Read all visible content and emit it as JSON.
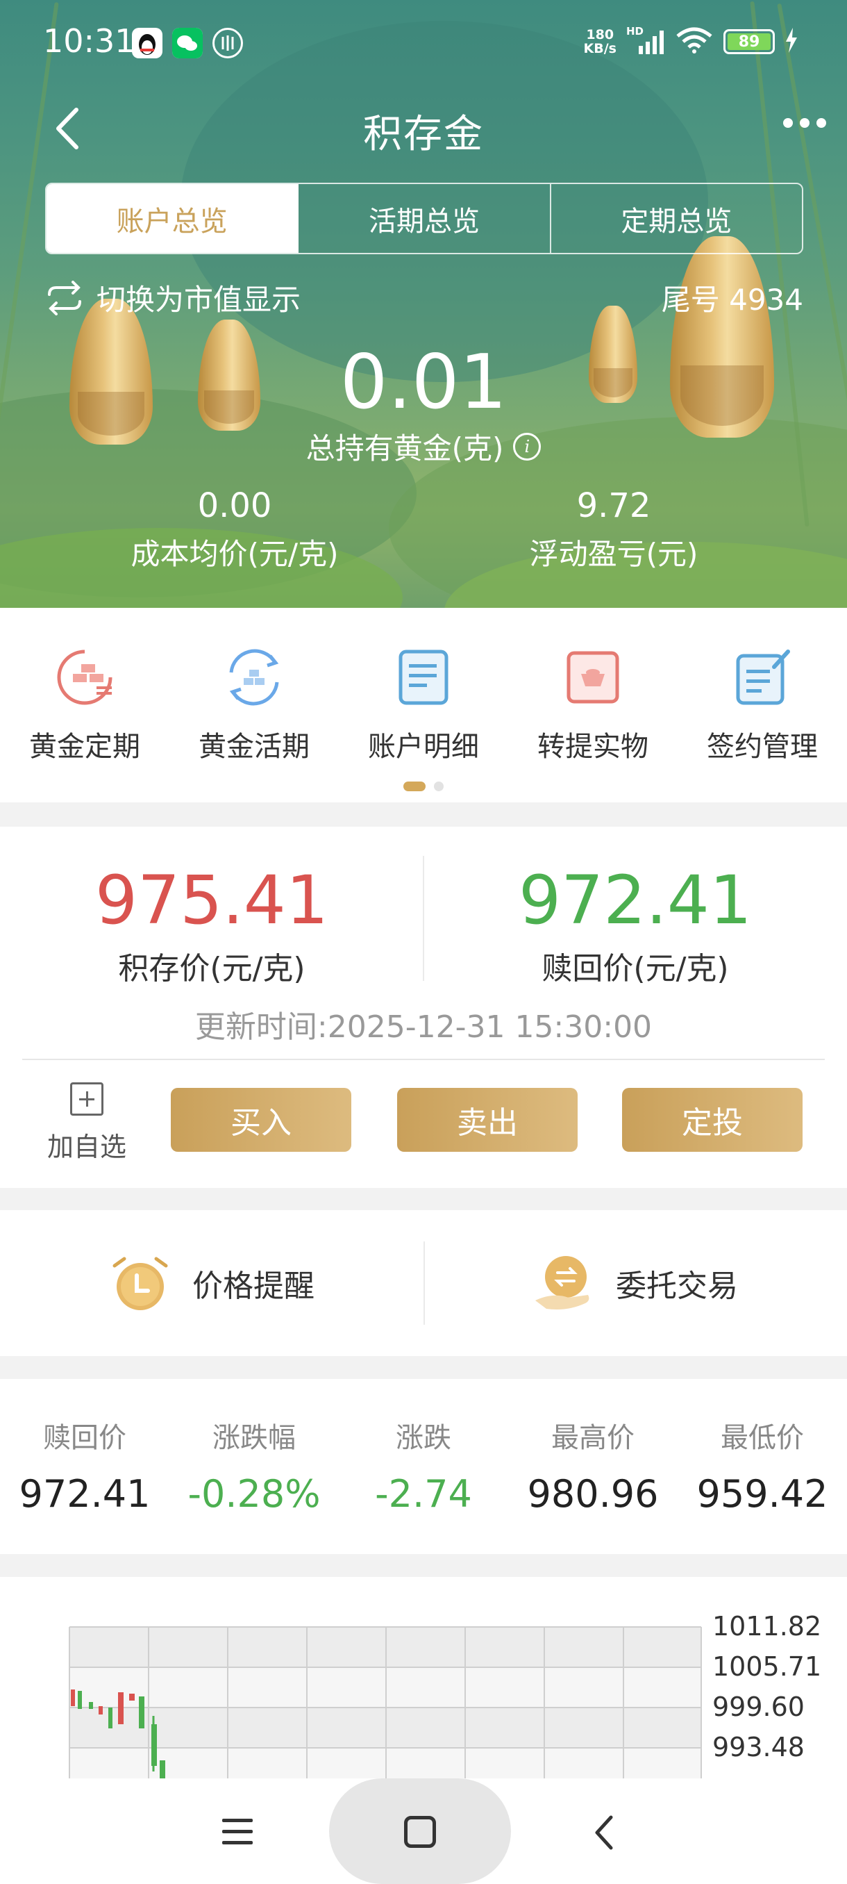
{
  "status_bar": {
    "time": "10:31",
    "net_speed_value": "180",
    "net_speed_unit": "KB/s",
    "signal_label": "HD",
    "battery": "89"
  },
  "nav": {
    "title": "积存金"
  },
  "tabs": [
    {
      "label": "账户总览",
      "active": true
    },
    {
      "label": "活期总览",
      "active": false
    },
    {
      "label": "定期总览",
      "active": false
    }
  ],
  "account": {
    "switch_label": "切换为市值显示",
    "tail_label": "尾号 4934",
    "total_value": "0.01",
    "total_label": "总持有黄金(克)",
    "cost_value": "0.00",
    "cost_label": "成本均价(元/克)",
    "pnl_value": "9.72",
    "pnl_label": "浮动盈亏(元)"
  },
  "shortcuts": [
    {
      "label": "黄金定期",
      "icon": "gold-fixed-icon"
    },
    {
      "label": "黄金活期",
      "icon": "gold-current-icon"
    },
    {
      "label": "账户明细",
      "icon": "account-detail-icon"
    },
    {
      "label": "转提实物",
      "icon": "physical-withdraw-icon"
    },
    {
      "label": "签约管理",
      "icon": "contract-manage-icon"
    }
  ],
  "prices": {
    "buy_value": "975.41",
    "buy_label": "积存价(元/克)",
    "sell_value": "972.41",
    "sell_label": "赎回价(元/克)",
    "updated": "更新时间:2025-12-31 15:30:00",
    "add_fav_label": "加自选",
    "buy_btn": "买入",
    "sell_btn": "卖出",
    "plan_btn": "定投"
  },
  "tools": {
    "alert_label": "价格提醒",
    "entrust_label": "委托交易"
  },
  "quote": [
    {
      "label": "赎回价",
      "value": "972.41"
    },
    {
      "label": "涨跌幅",
      "value": "-0.28%"
    },
    {
      "label": "涨跌",
      "value": "-2.74"
    },
    {
      "label": "最高价",
      "value": "980.96"
    },
    {
      "label": "最低价",
      "value": "959.42"
    }
  ],
  "chart_axis": [
    "1011.82",
    "1005.71",
    "999.60",
    "993.48"
  ],
  "colors": {
    "up": "#d9534f",
    "down": "#4caf50",
    "accent": "#c9a25b"
  }
}
